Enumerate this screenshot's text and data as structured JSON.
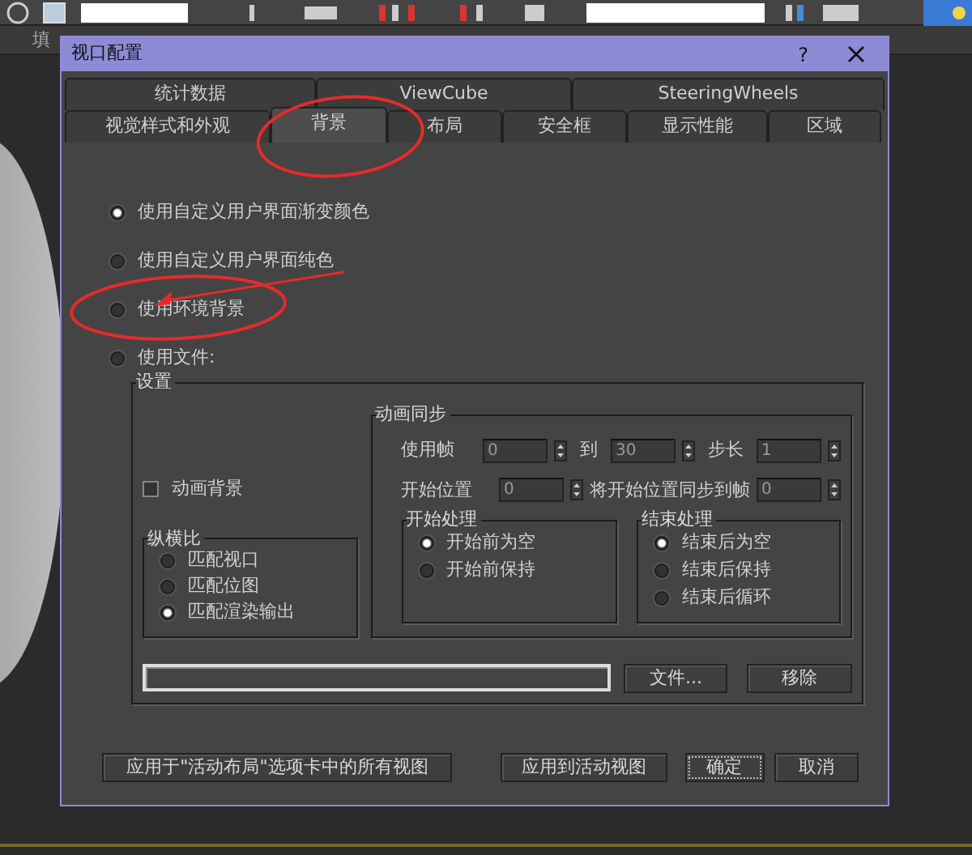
{
  "app": {
    "ribbon_tab": "填"
  },
  "dialog": {
    "title": "视口配置",
    "help": "?",
    "tab_rows": [
      [
        {
          "label": "统计数据",
          "selected": false
        },
        {
          "label": "ViewCube",
          "selected": false
        },
        {
          "label": "SteeringWheels",
          "selected": false
        }
      ],
      [
        {
          "label": "视觉样式和外观",
          "selected": false
        },
        {
          "label": "背景",
          "selected": true
        },
        {
          "label": "布局",
          "selected": false
        },
        {
          "label": "安全框",
          "selected": false
        },
        {
          "label": "显示性能",
          "selected": false
        },
        {
          "label": "区域",
          "selected": false
        }
      ]
    ],
    "background_options": [
      {
        "label": "使用自定义用户界面渐变颜色",
        "selected": true
      },
      {
        "label": "使用自定义用户界面纯色",
        "selected": false
      },
      {
        "label": "使用环境背景",
        "selected": false
      },
      {
        "label": "使用文件:",
        "selected": false
      }
    ],
    "settings": {
      "title": "设置",
      "animate_background": {
        "label": "动画背景",
        "checked": false
      },
      "aspect_ratio": {
        "title": "纵横比",
        "options": [
          {
            "label": "匹配视口",
            "selected": false
          },
          {
            "label": "匹配位图",
            "selected": false
          },
          {
            "label": "匹配渲染输出",
            "selected": true
          }
        ]
      },
      "animation_sync": {
        "title": "动画同步",
        "use_frame_label": "使用帧",
        "use_frame_from": "0",
        "to_label": "到",
        "use_frame_to": "30",
        "step_label": "步长",
        "step": "1",
        "start_label": "开始位置",
        "start": "0",
        "sync_label": "将开始位置同步到帧",
        "sync_frame": "0",
        "start_processing": {
          "title": "开始处理",
          "options": [
            {
              "label": "开始前为空",
              "selected": true
            },
            {
              "label": "开始前保持",
              "selected": false
            }
          ]
        },
        "end_processing": {
          "title": "结束处理",
          "options": [
            {
              "label": "结束后为空",
              "selected": true
            },
            {
              "label": "结束后保持",
              "selected": false
            },
            {
              "label": "结束后循环",
              "selected": false
            }
          ]
        }
      },
      "file_button": "文件...",
      "remove_button": "移除"
    },
    "buttons": [
      {
        "label": "应用于\"活动布局\"选项卡中的所有视图",
        "focused": false
      },
      {
        "label": "应用到活动视图",
        "focused": false
      },
      {
        "label": "确定",
        "focused": true
      },
      {
        "label": "取消",
        "focused": false
      }
    ]
  }
}
